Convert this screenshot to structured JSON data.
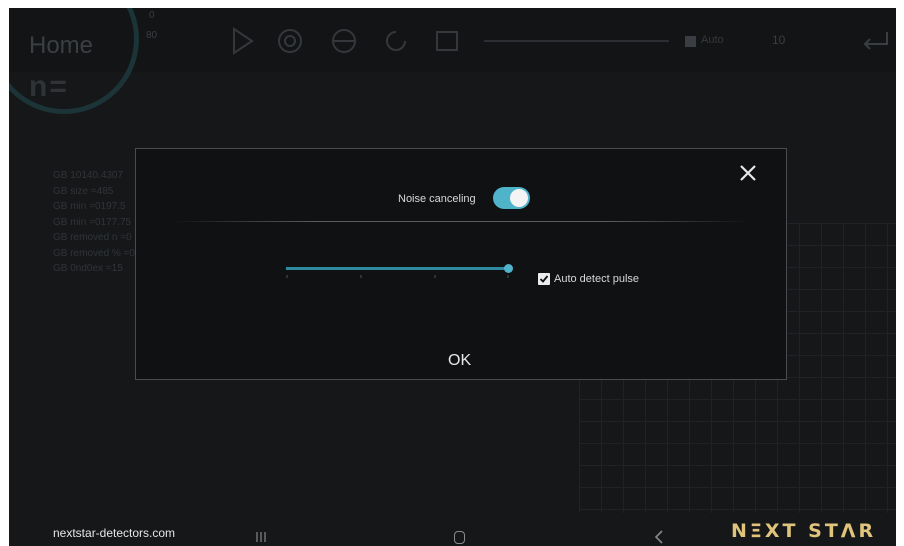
{
  "background": {
    "home_title": "Home",
    "home_sub": "n=",
    "gauge_top": "0",
    "gauge_bottom": "80",
    "auto_label": "Auto",
    "count_value": "10",
    "stats": [
      "GB 10140.4307",
      "GB size =485",
      "GB min =0197.5",
      "GB min =0177.75",
      "GB removed n =0",
      "GB removed % =0",
      "GB 0nd0ex =15"
    ]
  },
  "dialog": {
    "noise_canceling_label": "Noise canceling",
    "noise_canceling_on": true,
    "slider_level": 1.0,
    "auto_detect_label": "Auto detect pulse",
    "auto_detect_checked": true,
    "ok_label": "OK"
  },
  "footer": {
    "website": "nextstar-detectors.com",
    "brand": "NΞXT STΛR"
  },
  "colors": {
    "accent": "#4fb3c9",
    "brand": "#e0c47c",
    "screen_bg": "#161718"
  },
  "icons": [
    "play-icon",
    "target-icon",
    "globe-icon",
    "refresh-icon",
    "battery-icon",
    "enter-icon",
    "close-icon",
    "check-icon",
    "recents-icon",
    "home-nav-icon",
    "back-icon"
  ]
}
